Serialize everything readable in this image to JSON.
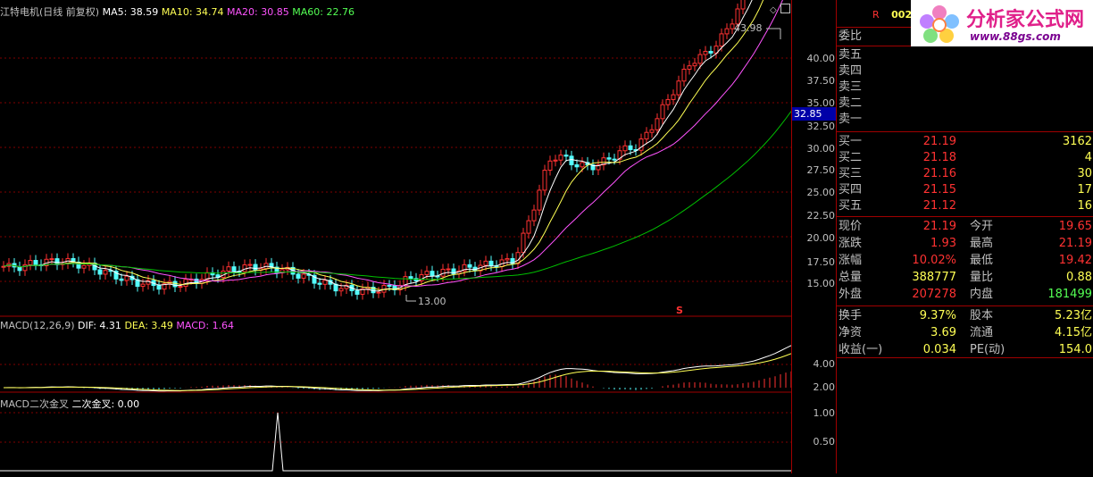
{
  "main_chart": {
    "title": "江特电机(日线 前复权)",
    "ma5": "MA5: 38.59",
    "ma10": "MA10: 34.74",
    "ma20": "MA20: 30.85",
    "ma60": "MA60: 22.76",
    "high_marker": "43.98",
    "low_marker": "13.00",
    "s_marker": "S"
  },
  "price_axis": {
    "ticks": [
      "40.00",
      "37.50",
      "35.00",
      "32.50",
      "30.00",
      "27.50",
      "25.00",
      "22.50",
      "20.00",
      "17.50",
      "15.00"
    ],
    "current_tag": "32.85",
    "macd_ticks": [
      "4.00",
      "2.00"
    ],
    "cross_ticks": [
      "1.00",
      "0.50"
    ]
  },
  "macd_panel": {
    "name": "MACD(12,26,9)",
    "dif": "DIF: 4.31",
    "dea": "DEA: 3.49",
    "macd": "MACD: 1.64"
  },
  "cross_panel": {
    "name": "MACD二次金叉",
    "label": "二次金叉: 0.00"
  },
  "side_panel": {
    "code_prefix": "R",
    "code": "0021",
    "order_ratio_label": "委比",
    "sell_labels": [
      "卖五",
      "卖四",
      "卖三",
      "卖二",
      "卖一"
    ],
    "buy_rows": [
      {
        "label": "买一",
        "price": "21.19",
        "vol": "3162"
      },
      {
        "label": "买二",
        "price": "21.18",
        "vol": "4"
      },
      {
        "label": "买三",
        "price": "21.16",
        "vol": "30"
      },
      {
        "label": "买四",
        "price": "21.15",
        "vol": "17"
      },
      {
        "label": "买五",
        "price": "21.12",
        "vol": "16"
      }
    ],
    "quote_rows": [
      {
        "l1": "现价",
        "v1": "21.19",
        "l2": "今开",
        "v2": "19.65"
      },
      {
        "l1": "涨跌",
        "v1": "1.93",
        "l2": "最高",
        "v2": "21.19"
      },
      {
        "l1": "涨幅",
        "v1": "10.02%",
        "l2": "最低",
        "v2": "19.42"
      },
      {
        "l1": "总量",
        "v1": "388777",
        "l2": "量比",
        "v2": "0.88"
      },
      {
        "l1": "外盘",
        "v1": "207278",
        "l2": "内盘",
        "v2": "181499"
      }
    ],
    "stat_rows": [
      {
        "l1": "换手",
        "v1": "9.37%",
        "l2": "股本",
        "v2": "5.23亿"
      },
      {
        "l1": "净资",
        "v1": "3.69",
        "l2": "流通",
        "v2": "4.15亿"
      },
      {
        "l1": "收益(一)",
        "v1": "0.034",
        "l2": "PE(动)",
        "v2": "154.0"
      }
    ]
  },
  "logo": {
    "title": "分析家公式网",
    "url": "www.88gs.com"
  },
  "colors": {
    "up": "#ff3232",
    "down": "#54ffff",
    "ma5": "#ffffff",
    "ma10": "#ffff54",
    "ma20": "#ff54ff",
    "ma60": "#00c000",
    "grid": "#800000"
  }
}
